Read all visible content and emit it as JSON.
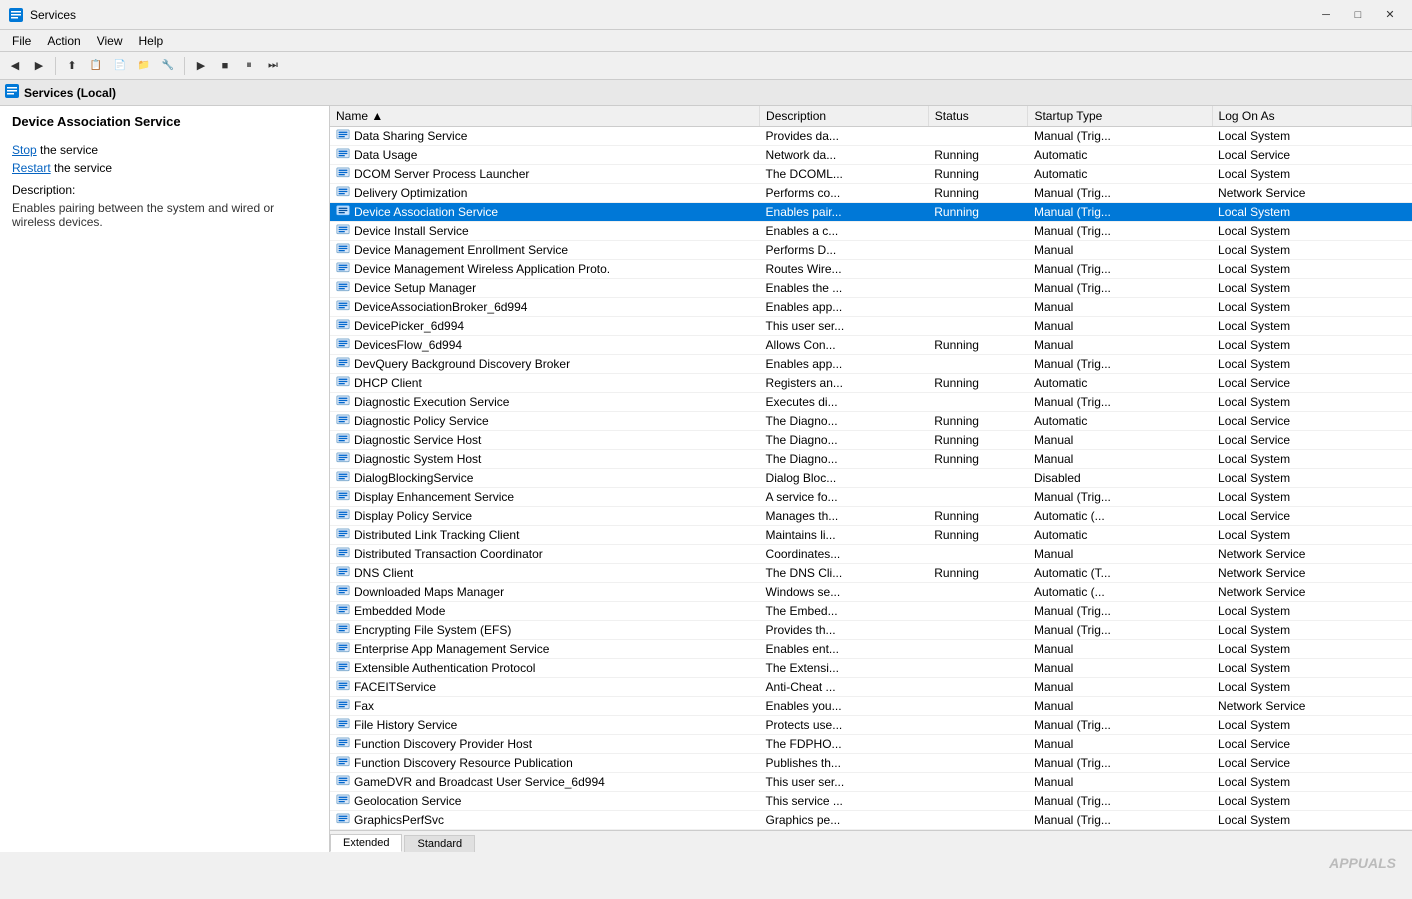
{
  "titleBar": {
    "title": "Services",
    "minimizeLabel": "─",
    "maximizeLabel": "□",
    "closeLabel": "✕"
  },
  "menuBar": {
    "items": [
      "File",
      "Action",
      "View",
      "Help"
    ]
  },
  "toolbar": {
    "buttons": [
      "◀",
      "▶",
      "⬆",
      "⬇",
      "✕",
      "↺",
      "⚙",
      "▣",
      "▶",
      "■",
      "⏸",
      "⏭"
    ]
  },
  "navBar": {
    "label": "Services (Local)"
  },
  "leftPanel": {
    "selectedService": "Device Association Service",
    "stopLabel": "Stop",
    "stopText": " the service",
    "restartLabel": "Restart",
    "restartText": " the service",
    "descriptionLabel": "Description:",
    "description": "Enables pairing between the system and wired or wireless devices."
  },
  "tableHeaders": [
    "Name",
    "Description",
    "Status",
    "Startup Type",
    "Log On As"
  ],
  "services": [
    {
      "name": "Data Sharing Service",
      "description": "Provides da...",
      "status": "",
      "startup": "Manual (Trig...",
      "logon": "Local System",
      "selected": false
    },
    {
      "name": "Data Usage",
      "description": "Network da...",
      "status": "Running",
      "startup": "Automatic",
      "logon": "Local Service",
      "selected": false
    },
    {
      "name": "DCOM Server Process Launcher",
      "description": "The DCOML...",
      "status": "Running",
      "startup": "Automatic",
      "logon": "Local System",
      "selected": false
    },
    {
      "name": "Delivery Optimization",
      "description": "Performs co...",
      "status": "Running",
      "startup": "Manual (Trig...",
      "logon": "Network Service",
      "selected": false
    },
    {
      "name": "Device Association Service",
      "description": "Enables pair...",
      "status": "Running",
      "startup": "Manual (Trig...",
      "logon": "Local System",
      "selected": true
    },
    {
      "name": "Device Install Service",
      "description": "Enables a c...",
      "status": "",
      "startup": "Manual (Trig...",
      "logon": "Local System",
      "selected": false
    },
    {
      "name": "Device Management Enrollment Service",
      "description": "Performs D...",
      "status": "",
      "startup": "Manual",
      "logon": "Local System",
      "selected": false
    },
    {
      "name": "Device Management Wireless Application Proto...",
      "description": "Routes Wire...",
      "status": "",
      "startup": "Manual (Trig...",
      "logon": "Local System",
      "selected": false
    },
    {
      "name": "Device Setup Manager",
      "description": "Enables the ...",
      "status": "",
      "startup": "Manual (Trig...",
      "logon": "Local System",
      "selected": false
    },
    {
      "name": "DeviceAssociationBroker_6d994",
      "description": "Enables app...",
      "status": "",
      "startup": "Manual",
      "logon": "Local System",
      "selected": false
    },
    {
      "name": "DevicePicker_6d994",
      "description": "This user ser...",
      "status": "",
      "startup": "Manual",
      "logon": "Local System",
      "selected": false
    },
    {
      "name": "DevicesFlow_6d994",
      "description": "Allows Con...",
      "status": "Running",
      "startup": "Manual",
      "logon": "Local System",
      "selected": false
    },
    {
      "name": "DevQuery Background Discovery Broker",
      "description": "Enables app...",
      "status": "",
      "startup": "Manual (Trig...",
      "logon": "Local System",
      "selected": false
    },
    {
      "name": "DHCP Client",
      "description": "Registers an...",
      "status": "Running",
      "startup": "Automatic",
      "logon": "Local Service",
      "selected": false
    },
    {
      "name": "Diagnostic Execution Service",
      "description": "Executes di...",
      "status": "",
      "startup": "Manual (Trig...",
      "logon": "Local System",
      "selected": false
    },
    {
      "name": "Diagnostic Policy Service",
      "description": "The Diagno...",
      "status": "Running",
      "startup": "Automatic",
      "logon": "Local Service",
      "selected": false
    },
    {
      "name": "Diagnostic Service Host",
      "description": "The Diagno...",
      "status": "Running",
      "startup": "Manual",
      "logon": "Local Service",
      "selected": false
    },
    {
      "name": "Diagnostic System Host",
      "description": "The Diagno...",
      "status": "Running",
      "startup": "Manual",
      "logon": "Local System",
      "selected": false
    },
    {
      "name": "DialogBlockingService",
      "description": "Dialog Bloc...",
      "status": "",
      "startup": "Disabled",
      "logon": "Local System",
      "selected": false
    },
    {
      "name": "Display Enhancement Service",
      "description": "A service fo...",
      "status": "",
      "startup": "Manual (Trig...",
      "logon": "Local System",
      "selected": false
    },
    {
      "name": "Display Policy Service",
      "description": "Manages th...",
      "status": "Running",
      "startup": "Automatic (...",
      "logon": "Local Service",
      "selected": false
    },
    {
      "name": "Distributed Link Tracking Client",
      "description": "Maintains li...",
      "status": "Running",
      "startup": "Automatic",
      "logon": "Local System",
      "selected": false
    },
    {
      "name": "Distributed Transaction Coordinator",
      "description": "Coordinates...",
      "status": "",
      "startup": "Manual",
      "logon": "Network Service",
      "selected": false
    },
    {
      "name": "DNS Client",
      "description": "The DNS Cli...",
      "status": "Running",
      "startup": "Automatic (T...",
      "logon": "Network Service",
      "selected": false
    },
    {
      "name": "Downloaded Maps Manager",
      "description": "Windows se...",
      "status": "",
      "startup": "Automatic (...",
      "logon": "Network Service",
      "selected": false
    },
    {
      "name": "Embedded Mode",
      "description": "The Embed...",
      "status": "",
      "startup": "Manual (Trig...",
      "logon": "Local System",
      "selected": false
    },
    {
      "name": "Encrypting File System (EFS)",
      "description": "Provides th...",
      "status": "",
      "startup": "Manual (Trig...",
      "logon": "Local System",
      "selected": false
    },
    {
      "name": "Enterprise App Management Service",
      "description": "Enables ent...",
      "status": "",
      "startup": "Manual",
      "logon": "Local System",
      "selected": false
    },
    {
      "name": "Extensible Authentication Protocol",
      "description": "The Extensi...",
      "status": "",
      "startup": "Manual",
      "logon": "Local System",
      "selected": false
    },
    {
      "name": "FACEITService",
      "description": "Anti-Cheat ...",
      "status": "",
      "startup": "Manual",
      "logon": "Local System",
      "selected": false
    },
    {
      "name": "Fax",
      "description": "Enables you...",
      "status": "",
      "startup": "Manual",
      "logon": "Network Service",
      "selected": false
    },
    {
      "name": "File History Service",
      "description": "Protects use...",
      "status": "",
      "startup": "Manual (Trig...",
      "logon": "Local System",
      "selected": false
    },
    {
      "name": "Function Discovery Provider Host",
      "description": "The FDPHO...",
      "status": "",
      "startup": "Manual",
      "logon": "Local Service",
      "selected": false
    },
    {
      "name": "Function Discovery Resource Publication",
      "description": "Publishes th...",
      "status": "",
      "startup": "Manual (Trig...",
      "logon": "Local Service",
      "selected": false
    },
    {
      "name": "GameDVR and Broadcast User Service_6d994",
      "description": "This user ser...",
      "status": "",
      "startup": "Manual",
      "logon": "Local System",
      "selected": false
    },
    {
      "name": "Geolocation Service",
      "description": "This service ...",
      "status": "",
      "startup": "Manual (Trig...",
      "logon": "Local System",
      "selected": false
    },
    {
      "name": "GraphicsPerfSvc",
      "description": "Graphics pe...",
      "status": "",
      "startup": "Manual (Trig...",
      "logon": "Local System",
      "selected": false
    }
  ],
  "bottomTabs": {
    "tabs": [
      "Extended",
      "Standard"
    ],
    "activeTab": "Extended"
  },
  "watermark": "APPUALS"
}
